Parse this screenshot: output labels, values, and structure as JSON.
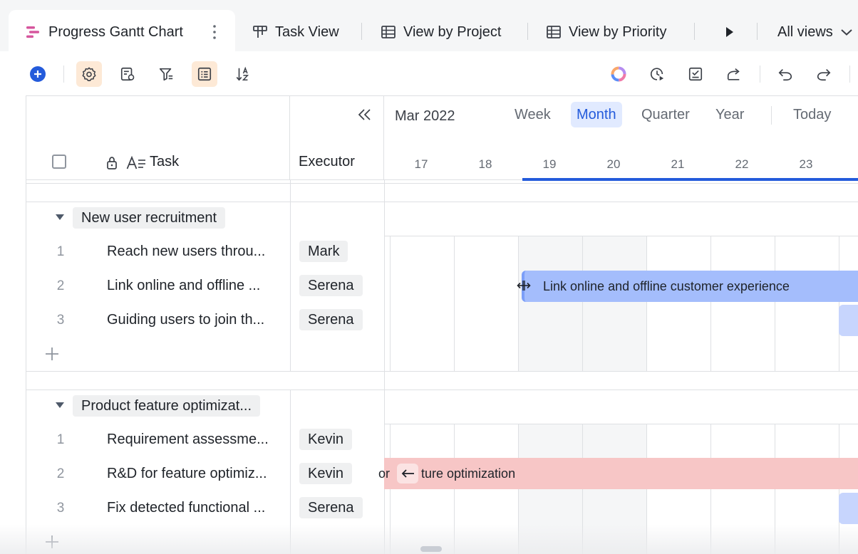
{
  "tabs": {
    "items": [
      {
        "label": "Progress Gantt Chart",
        "icon": "gantt-icon"
      },
      {
        "label": "Task View",
        "icon": "kanban-icon"
      },
      {
        "label": "View by Project",
        "icon": "table-icon"
      },
      {
        "label": "View by Priority",
        "icon": "table-icon"
      }
    ],
    "all_views_label": "All views"
  },
  "toolbar": {
    "icons": [
      "add-icon",
      "settings-icon",
      "field-settings-icon",
      "filter-icon",
      "group-icon",
      "sort-icon",
      "color-ring-icon",
      "history-icon",
      "checklist-icon",
      "share-icon",
      "undo-icon",
      "redo-icon"
    ]
  },
  "header": {
    "task_col": "Task",
    "executor_col": "Executor",
    "month_label": "Mar 2022",
    "periods": [
      "Week",
      "Month",
      "Quarter",
      "Year"
    ],
    "active_period": "Month",
    "today_label": "Today",
    "days": [
      "17",
      "18",
      "19",
      "20",
      "21",
      "22",
      "23"
    ]
  },
  "groups": [
    {
      "name": "New user recruitment",
      "rows": [
        {
          "num": "1",
          "task": "Reach new users throu...",
          "executor": "Mark"
        },
        {
          "num": "2",
          "task": "Link online and offline ...",
          "executor": "Serena"
        },
        {
          "num": "3",
          "task": "Guiding users to join th...",
          "executor": "Serena"
        }
      ]
    },
    {
      "name": "Product feature optimizat...",
      "rows": [
        {
          "num": "1",
          "task": "Requirement assessme...",
          "executor": "Kevin"
        },
        {
          "num": "2",
          "task": "R&D for feature optimiz...",
          "executor": "Kevin"
        },
        {
          "num": "3",
          "task": "Fix detected functional ...",
          "executor": "Serena"
        }
      ]
    }
  ],
  "bars": {
    "blue_label": "Link online and offline customer experience",
    "red_prefix": "or",
    "red_label": "ture optimization"
  },
  "colors": {
    "accent": "#245bdb",
    "bar_blue": "#a4bdfc",
    "bar_red": "#f7c6c6",
    "active_toolbar": "#fde9d6"
  }
}
